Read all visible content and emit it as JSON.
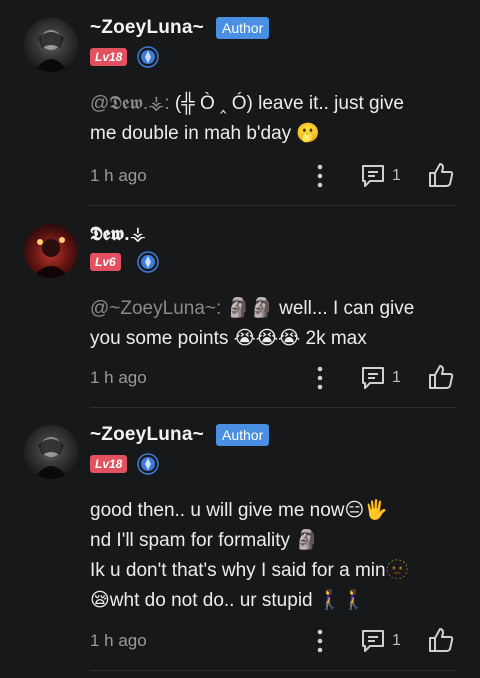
{
  "comments": [
    {
      "username": "~ZoeyLuna~",
      "author_badge": "Author",
      "level": "Lv18",
      "mention": "@𝕯𝖊𝖜.⚶:",
      "text_line1": " (╬ Ò ‸ Ó) leave it.. just give",
      "text_line2": "me double in mah b'day 🫢",
      "time": "1 h ago",
      "reply_count": "1"
    },
    {
      "username": "𝕯𝖊𝖜.⚶",
      "level": "Lv6",
      "mention": "@~ZoeyLuna~:",
      "text_line1": " 🗿🗿 well... I can give",
      "text_line2": "you some points 😭😭😭 2k max",
      "time": "1 h ago",
      "reply_count": "1"
    },
    {
      "username": "~ZoeyLuna~",
      "author_badge": "Author",
      "level": "Lv18",
      "text_line1": "good then..  u will give me now😑🖐",
      "text_line2": "nd I'll spam for formality 🗿",
      "text_line3": "Ik u don't that's why I said for a min🫥",
      "text_line4": "😪wht do not do..  ur stupid 🚶‍♀️🚶‍♀️",
      "time": "1 h ago",
      "reply_count": "1"
    }
  ],
  "icons": {
    "more": "more-vertical-icon",
    "reply": "comment-bubble-icon",
    "like": "thumbs-up-icon",
    "rank": "rank-gem-icon"
  },
  "colors": {
    "background": "#17181a",
    "author_badge": "#4a90e2",
    "level_badge": "#e2515f",
    "rank_icon": "#3d7bd9",
    "mention": "#8a8a8a",
    "meta": "#9a9a9a"
  }
}
